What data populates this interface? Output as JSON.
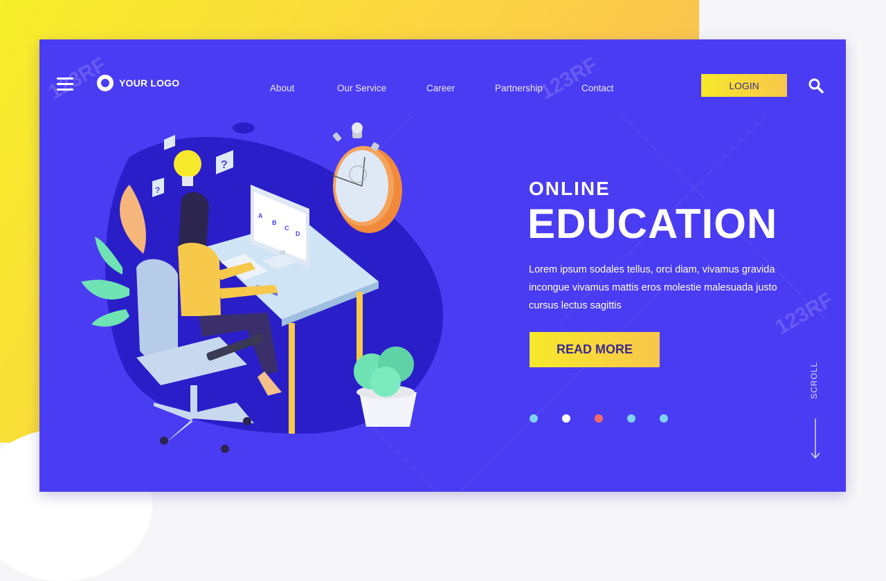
{
  "header": {
    "logo_text": "YOUR LOGO",
    "nav": [
      "About",
      "Our Service",
      "Career",
      "Partnership",
      "Contact"
    ],
    "login_label": "LOGIN"
  },
  "hero": {
    "subtitle": "ONLINE",
    "title": "EDUCATION",
    "body": "Lorem ipsum sodales tellus, orci diam, vivamus gravida incongue vivamus mattis eros molestie malesuada justo cursus lectus sagittis",
    "cta_label": "READ MORE"
  },
  "pagination": {
    "count": 5,
    "active_index": 2,
    "colors": [
      "#7fd3f7",
      "#ffffff",
      "#f06a6a",
      "#7fd3f7",
      "#7fd3f7"
    ]
  },
  "scroll_label": "SCROLL",
  "quiz_letters": [
    "A",
    "B",
    "C",
    "D"
  ],
  "watermark": "123RF",
  "colors": {
    "card": "#4a3cf2",
    "accent_yellow": "#f7e92b",
    "button_text": "#3b2b8c"
  },
  "icons": [
    "hamburger-menu-icon",
    "logo-ring-icon",
    "search-icon",
    "scroll-down-arrow-icon"
  ]
}
